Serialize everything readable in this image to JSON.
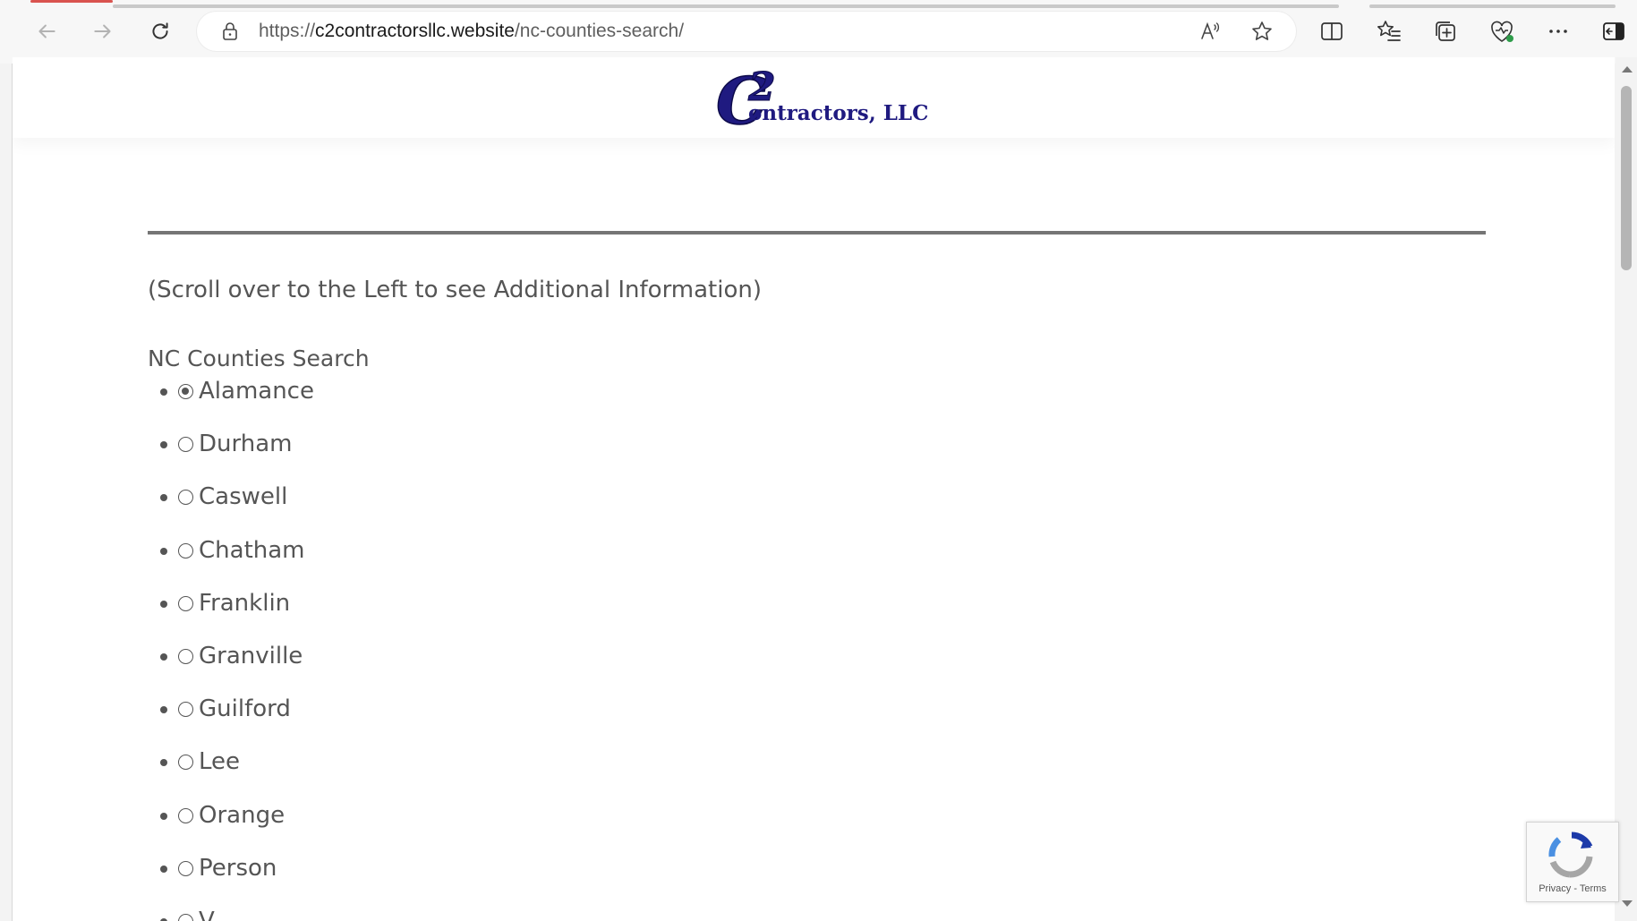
{
  "browser": {
    "url_prefix": "https://",
    "url_host": "c2contractorsllc.website",
    "url_path": "/nc-counties-search/"
  },
  "logo": {
    "big_text": "C",
    "digit": "2",
    "rest_text": "ontractors, LLC",
    "brand_color": "#1f1a80"
  },
  "page": {
    "note": "(Scroll over to the Left to see Additional Information)",
    "search_title": "NC Counties Search",
    "counties": [
      {
        "label": "Alamance",
        "checked": true
      },
      {
        "label": "Durham",
        "checked": false
      },
      {
        "label": "Caswell",
        "checked": false
      },
      {
        "label": "Chatham",
        "checked": false
      },
      {
        "label": "Franklin",
        "checked": false
      },
      {
        "label": "Granville",
        "checked": false
      },
      {
        "label": "Guilford",
        "checked": false
      },
      {
        "label": "Lee",
        "checked": false
      },
      {
        "label": "Orange",
        "checked": false
      },
      {
        "label": "Person",
        "checked": false
      },
      {
        "label": "V",
        "checked": false
      }
    ]
  },
  "recaptcha": {
    "privacy": "Privacy",
    "sep": " - ",
    "terms": "Terms"
  }
}
